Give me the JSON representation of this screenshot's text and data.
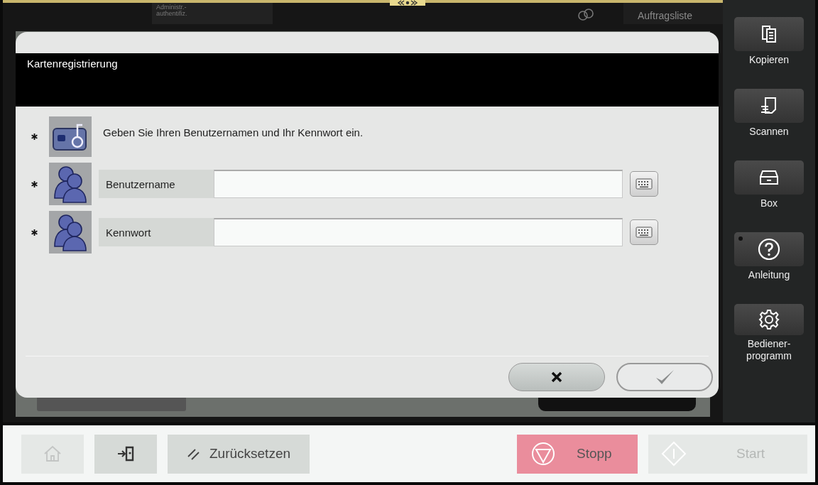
{
  "header": {
    "auth_label": "Administr.-\nauthentifiz.",
    "job_list": "Auftragsliste"
  },
  "dialog": {
    "title": "Kartenregistrierung",
    "instruction": {
      "text": "Geben Sie Ihren Benutzernamen und Ihr Kennwort ein.",
      "required": true
    },
    "fields": [
      {
        "label": "Benutzername",
        "required": true
      },
      {
        "label": "Kennwort",
        "required": true
      }
    ],
    "actions": [
      {
        "kind": "cancel",
        "disabled": false
      },
      {
        "kind": "ok",
        "disabled": true
      }
    ]
  },
  "sidebar": [
    {
      "kind": "copy",
      "label": "Kopieren",
      "indicator": false
    },
    {
      "kind": "scan",
      "label": "Scannen",
      "indicator": false
    },
    {
      "kind": "box",
      "label": "Box",
      "indicator": false
    },
    {
      "kind": "help",
      "label": "Anleitung",
      "indicator": true
    },
    {
      "kind": "settings",
      "label": "Bediener-\nprogramm",
      "indicator": false
    }
  ],
  "bottom_bar": [
    {
      "kind": "home",
      "disabled": true
    },
    {
      "kind": "logout",
      "disabled": false
    },
    {
      "kind": "reset",
      "label": "Zurücksetzen",
      "disabled": false
    },
    {
      "kind": "stop",
      "label": "Stopp",
      "disabled": false
    },
    {
      "kind": "start",
      "label": "Start",
      "disabled": true
    }
  ]
}
